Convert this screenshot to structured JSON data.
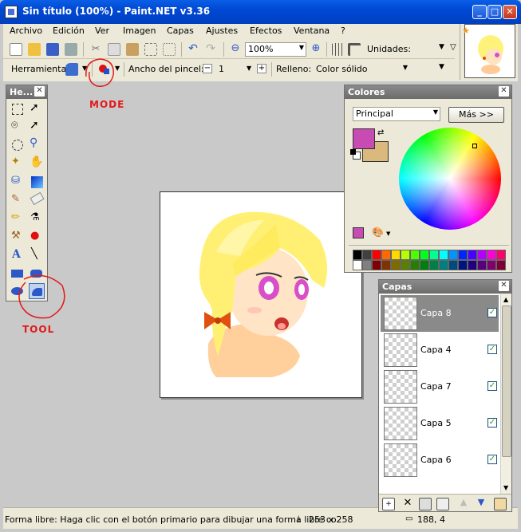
{
  "window": {
    "title": "Sin título (100%) - Paint.NET v3.36"
  },
  "menu": [
    "Archivo",
    "Edición",
    "Ver",
    "Imagen",
    "Capas",
    "Ajustes",
    "Efectos",
    "Ventana",
    "?"
  ],
  "toolbar": {
    "zoom": "100%",
    "units_label": "Unidades:"
  },
  "tool_options": {
    "tool_label": "Herramienta:",
    "brush_width_label": "Ancho del pincel:",
    "brush_width_value": "1",
    "fill_label": "Relleno:",
    "fill_value": "Color sólido"
  },
  "tools_panel": {
    "title": "He..."
  },
  "colors_panel": {
    "title": "Colores",
    "mode": "Principal",
    "more_button": "Más >>",
    "primary_color": "#c84bb4",
    "secondary_color": "#d9b97c",
    "palette": [
      "#000000",
      "#404040",
      "#ff0000",
      "#ff6a00",
      "#ffd800",
      "#b6ff00",
      "#4cff00",
      "#00ff21",
      "#00ff90",
      "#00ffff",
      "#0094ff",
      "#0026ff",
      "#4800ff",
      "#b200ff",
      "#ff00dc",
      "#ff006e",
      "#ffffff",
      "#808080",
      "#7f0000",
      "#7f3300",
      "#7f6a00",
      "#5b7f00",
      "#267f00",
      "#007f0e",
      "#007f46",
      "#007f7f",
      "#004a7f",
      "#00137f",
      "#21007f",
      "#57007f",
      "#7f006e",
      "#7f0037"
    ]
  },
  "layers_panel": {
    "title": "Capas",
    "layers": [
      {
        "name": "Capa 8",
        "checked": true,
        "selected": true
      },
      {
        "name": "Capa 4",
        "checked": true,
        "selected": false
      },
      {
        "name": "Capa 7",
        "checked": true,
        "selected": false
      },
      {
        "name": "Capa 5",
        "checked": true,
        "selected": false
      },
      {
        "name": "Capa 6",
        "checked": true,
        "selected": false
      }
    ]
  },
  "status": {
    "hint": "Forma libre: Haga clic con el botón primario para dibujar una forma libre co",
    "size": "253 x 258",
    "position": "188, 4"
  },
  "annotations": {
    "mode": "MODE",
    "tool": "TOOL"
  }
}
